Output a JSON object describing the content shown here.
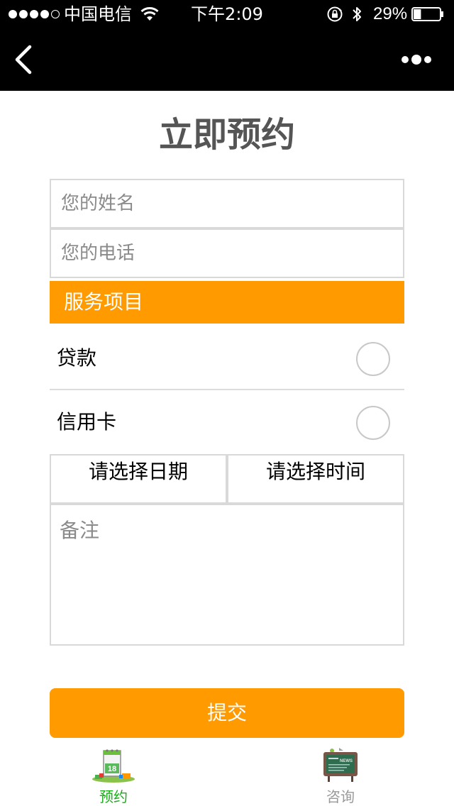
{
  "status_bar": {
    "carrier": "中国电信",
    "time": "下午2:09",
    "battery_percent": "29%",
    "battery_level": 0.29,
    "signal_bars_filled": 4,
    "signal_bars_total": 5,
    "icons": [
      "wifi-icon",
      "orientation-lock-icon",
      "bluetooth-icon",
      "battery-icon"
    ]
  },
  "nav": {
    "back_icon": "chevron-left-icon",
    "more_icon": "more-dots-icon"
  },
  "page": {
    "title": "立即预约"
  },
  "form": {
    "name_placeholder": "您的姓名",
    "phone_placeholder": "您的电话",
    "service_header": "服务项目",
    "options": [
      {
        "label": "贷款",
        "selected": false
      },
      {
        "label": "信用卡",
        "selected": false
      }
    ],
    "date_picker_label": "请选择日期",
    "time_picker_label": "请选择时间",
    "remarks_placeholder": "备注",
    "submit_label": "提交"
  },
  "tab_bar": {
    "tabs": [
      {
        "label": "预约",
        "icon": "calendar-icon",
        "active": true
      },
      {
        "label": "咨询",
        "icon": "news-board-icon",
        "active": false
      }
    ]
  },
  "colors": {
    "accent": "#ff9a00",
    "active_tab": "#1aad19",
    "inactive_tab": "#999999",
    "title": "#555555",
    "bar_background": "#000000"
  }
}
